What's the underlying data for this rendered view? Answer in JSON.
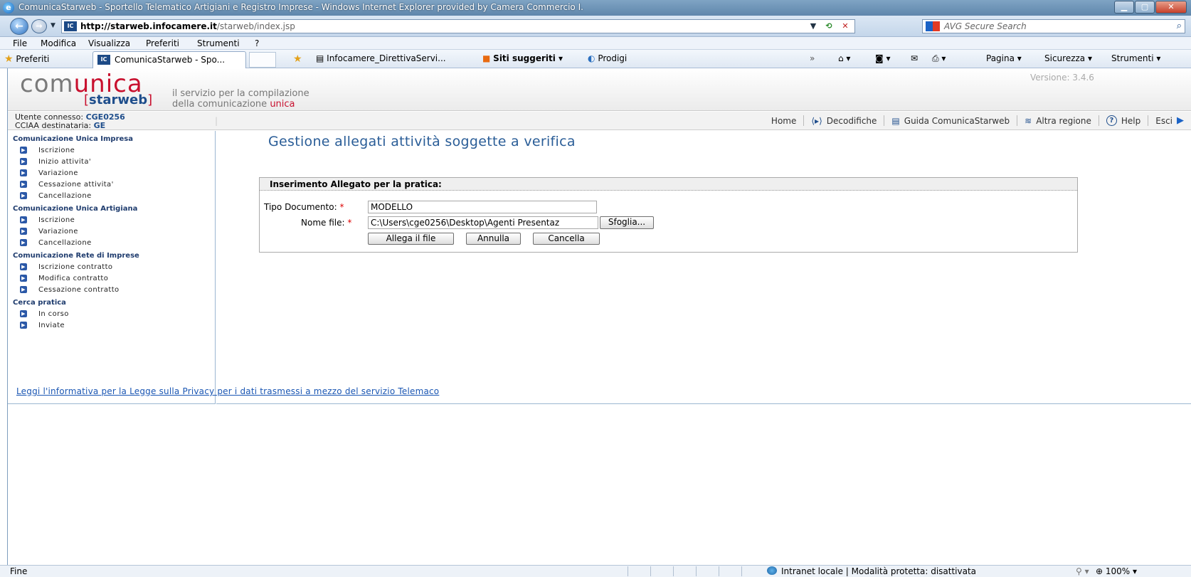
{
  "window": {
    "title": "ComunicaStarweb - Sportello Telematico Artigiani e Registro Imprese - Windows Internet Explorer provided by Camera Commercio I."
  },
  "address": {
    "url_host": "http://starweb.infocamere.it",
    "url_path": "/starweb/index.jsp",
    "search_placeholder": "AVG Secure Search"
  },
  "menubar": [
    "File",
    "Modifica",
    "Visualizza",
    "Preferiti",
    "Strumenti",
    "?"
  ],
  "favorites": {
    "preferiti": "Preferiti",
    "active_tab": "ComunicaStarweb - Spo...",
    "items": [
      "Infocamere_DirettivaServi...",
      "Siti suggeriti ▾",
      "Prodigi"
    ],
    "right_items": [
      "Pagina ▾",
      "Sicurezza ▾",
      "Strumenti ▾"
    ]
  },
  "brand": {
    "logo_comunica_a": "com",
    "logo_comunica_b": "unica",
    "logo_starweb": "starweb",
    "tagline_1": "il servizio per la compilazione",
    "tagline_2a": "della comunicazione ",
    "tagline_2b": "unica",
    "version": "Versione: 3.4.6"
  },
  "user": {
    "connected_label": "Utente connesso: ",
    "connected_value": "CGE0256",
    "cciaa_label": "CCIAA destinataria: ",
    "cciaa_value": "GE"
  },
  "topnav": {
    "home": "Home",
    "decodifiche": "Decodifiche",
    "guida": "Guida ComunicaStarweb",
    "altra_regione": "Altra regione",
    "help": "Help",
    "esci": "Esci"
  },
  "sidebar": {
    "sections": [
      {
        "title": "Comunicazione Unica Impresa",
        "items": [
          "Iscrizione",
          "Inizio attivita'",
          "Variazione",
          "Cessazione attivita'",
          "Cancellazione"
        ]
      },
      {
        "title": "Comunicazione Unica Artigiana",
        "items": [
          "Iscrizione",
          "Variazione",
          "Cancellazione"
        ]
      },
      {
        "title": "Comunicazione Rete di Imprese",
        "items": [
          "Iscrizione contratto",
          "Modifica contratto",
          "Cessazione contratto"
        ]
      },
      {
        "title": "Cerca pratica",
        "items": [
          "In corso",
          "Inviate"
        ]
      }
    ]
  },
  "main": {
    "title": "Gestione allegati attività soggette a verifica",
    "form": {
      "header": "Inserimento Allegato per la pratica:",
      "tipo_label": "Tipo Documento:",
      "tipo_value": "MODELLO",
      "nome_label": "Nome file:",
      "nome_value": "C:\\Users\\cge0256\\Desktop\\Agenti Presentaz",
      "required_mark": "*",
      "browse_label": "Sfoglia...",
      "attach_label": "Allega il file",
      "cancel_label": "Annulla",
      "delete_label": "Cancella"
    }
  },
  "privacy_link": "Leggi l'informativa per la Legge sulla Privacy per i dati trasmessi a mezzo del servizio Telemaco",
  "status": {
    "text": "Fine",
    "zone": "Intranet locale | Modalità protetta: disattivata",
    "zoom": "100%"
  }
}
